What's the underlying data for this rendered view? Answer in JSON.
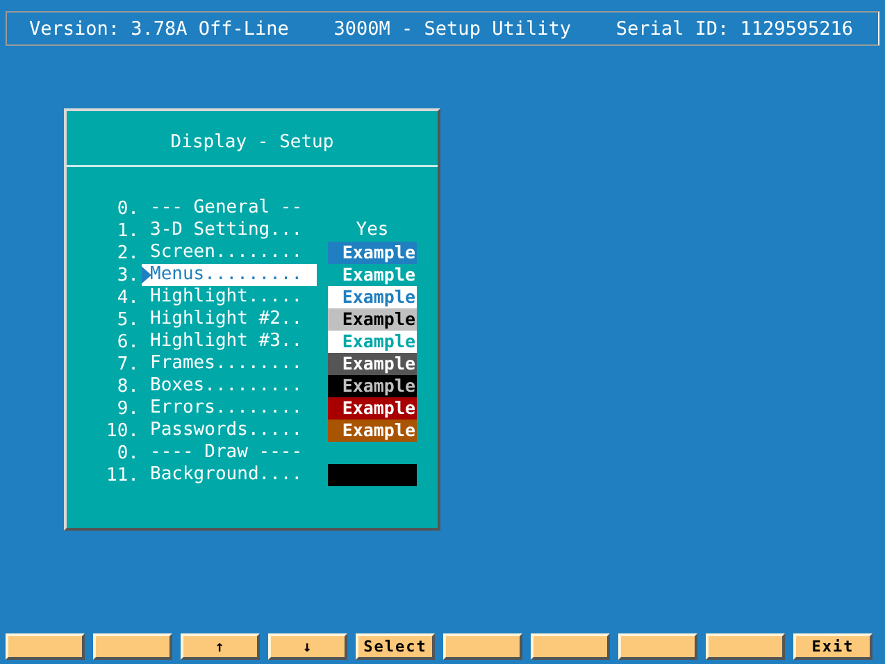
{
  "header": {
    "version": "Version: 3.78A Off-Line",
    "title": "3000M - Setup Utility",
    "serial": "Serial ID: 1129595216"
  },
  "dialog": {
    "title": "Display - Setup",
    "rows": [
      {
        "number": "0.",
        "label": "--- General --",
        "kind": "heading",
        "selected": false
      },
      {
        "number": "1.",
        "label": "3-D Setting...",
        "kind": "text",
        "value": "Yes",
        "selected": false
      },
      {
        "number": "2.",
        "label": "Screen........",
        "kind": "swatch",
        "color": "#1f7fc0",
        "sample": {
          "text": "Example",
          "color": "#ffffff"
        },
        "selected": false
      },
      {
        "number": "3.",
        "label": "Menus.........",
        "kind": "swatch",
        "color": "#00a8a8",
        "sample": {
          "text": "Example",
          "color": "#ffffff"
        },
        "selected": true
      },
      {
        "number": "4.",
        "label": "Highlight.....",
        "kind": "swatch",
        "color": "#ffffff",
        "sample": {
          "text": "Example",
          "color": "#1f7fc0"
        },
        "selected": false
      },
      {
        "number": "5.",
        "label": "Highlight #2..",
        "kind": "swatch",
        "color": "#c0c0c0",
        "sample": {
          "text": "Example",
          "color": "#000000"
        },
        "selected": false
      },
      {
        "number": "6.",
        "label": "Highlight #3..",
        "kind": "swatch",
        "color": "#ffffff",
        "sample": {
          "text": "Example",
          "color": "#00a8a8"
        },
        "selected": false
      },
      {
        "number": "7.",
        "label": "Frames........",
        "kind": "swatch",
        "color": "#555555",
        "sample": {
          "text": "Example",
          "color": "#ffffff"
        },
        "selected": false
      },
      {
        "number": "8.",
        "label": "Boxes.........",
        "kind": "swatch",
        "color": "#000000",
        "sample": {
          "text": "Example",
          "color": "#c0c0c0"
        },
        "selected": false
      },
      {
        "number": "9.",
        "label": "Errors........",
        "kind": "swatch",
        "color": "#a80000",
        "sample": {
          "text": "Example",
          "color": "#ffffff"
        },
        "selected": false
      },
      {
        "number": "10.",
        "label": "Passwords.....",
        "kind": "swatch",
        "color": "#a85400",
        "sample": {
          "text": "Example",
          "color": "#ffffff"
        },
        "selected": false
      },
      {
        "number": "0.",
        "label": "---- Draw ----",
        "kind": "heading",
        "selected": false
      },
      {
        "number": "11.",
        "label": "Background....",
        "kind": "swatch",
        "color": "#000000",
        "selected": false
      }
    ]
  },
  "buttons": [
    {
      "kind": "blank"
    },
    {
      "kind": "blank"
    },
    {
      "kind": "key",
      "label": "↑"
    },
    {
      "kind": "key",
      "label": "↓"
    },
    {
      "kind": "key",
      "label": "Select"
    },
    {
      "kind": "blank"
    },
    {
      "kind": "blank"
    },
    {
      "kind": "blank"
    },
    {
      "kind": "blank"
    },
    {
      "kind": "key",
      "label": "Exit"
    }
  ]
}
